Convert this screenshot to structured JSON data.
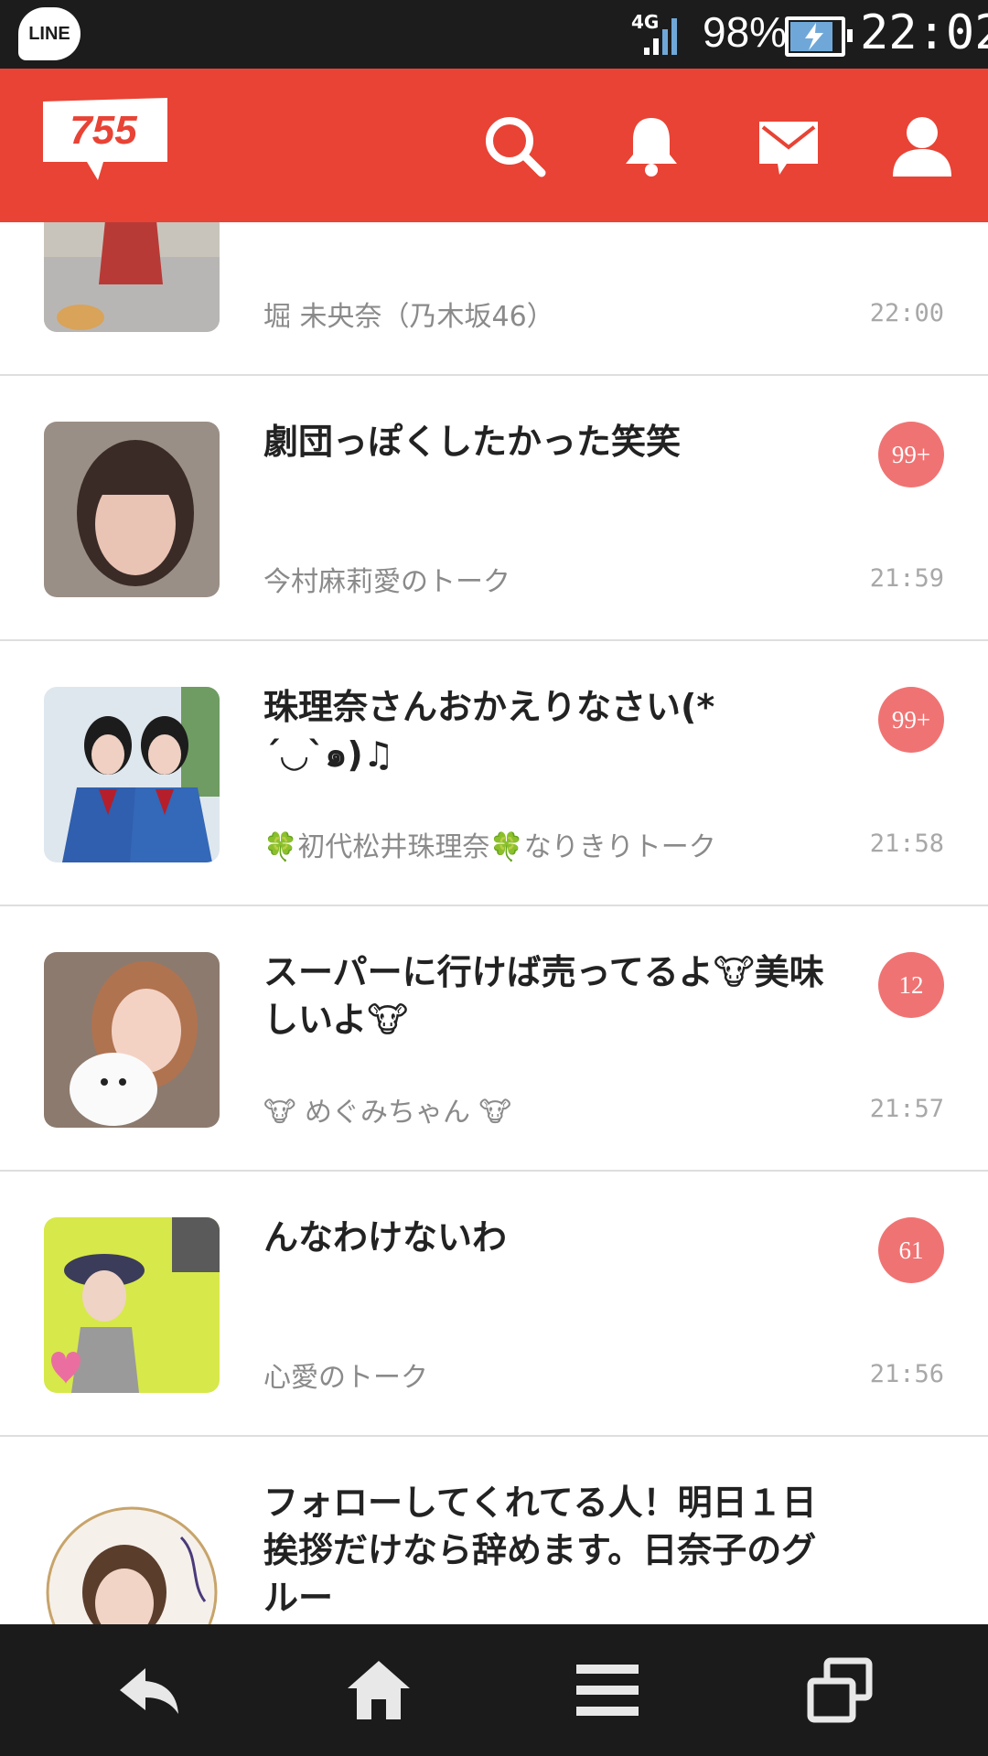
{
  "status": {
    "app_badge": "LINE",
    "network": "4G",
    "battery": "98%",
    "time": "22:02"
  },
  "header": {
    "logo": "755",
    "icons": [
      "search-icon",
      "bell-icon",
      "mail-icon",
      "profile-icon"
    ]
  },
  "colors": {
    "brand": "#e84335",
    "badge": "#f07373",
    "status_bar": "#1c1c1c",
    "nav_bar": "#1b1b1b"
  },
  "talks": [
    {
      "title": "",
      "room": "堀 未央奈（乃木坂46）",
      "time": "22:00",
      "unread": ""
    },
    {
      "title": "劇団っぽくしたかった笑笑",
      "room": "今村麻莉愛のトーク",
      "time": "21:59",
      "unread": "99+"
    },
    {
      "title": "珠理奈さんおかえりなさい(*´◡`๑)♫",
      "room": "🍀初代松井珠理奈🍀なりきりトーク",
      "time": "21:58",
      "unread": "99+"
    },
    {
      "title": "スーパーに行けば売ってるよ🐮美味しいよ🐮",
      "room": "🐮 めぐみちゃん 🐮",
      "time": "21:57",
      "unread": "12"
    },
    {
      "title": "んなわけないわ",
      "room": "心愛のトーク",
      "time": "21:56",
      "unread": "61"
    },
    {
      "title": "フォローしてくれてる人！明日１日挨拶だけなら辞めます。日奈子のグルー",
      "room": "",
      "time": "",
      "unread": ""
    }
  ],
  "navbar": {
    "icons": [
      "back-icon",
      "home-icon",
      "menu-icon",
      "recent-apps-icon"
    ]
  }
}
